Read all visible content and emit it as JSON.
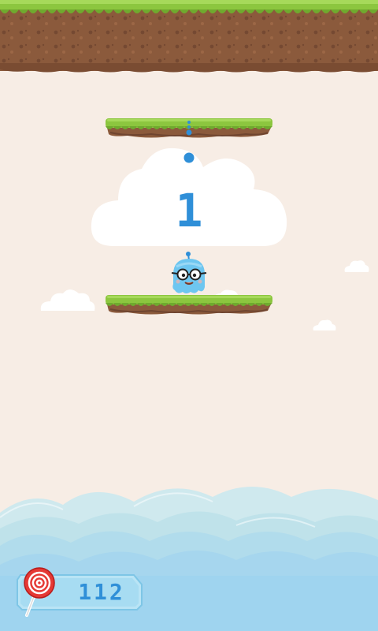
{
  "game": {
    "score": "1",
    "candy_count": "112"
  },
  "colors": {
    "background": "#f7ede5",
    "grass": "#8cc63f",
    "dirt": "#8b5a3c",
    "player": "#6ec6f0",
    "score_text": "#2f8fd8",
    "water": "#9fd8ee"
  },
  "icons": {
    "player": "blue-blob-character",
    "candy": "lollipop-icon"
  }
}
